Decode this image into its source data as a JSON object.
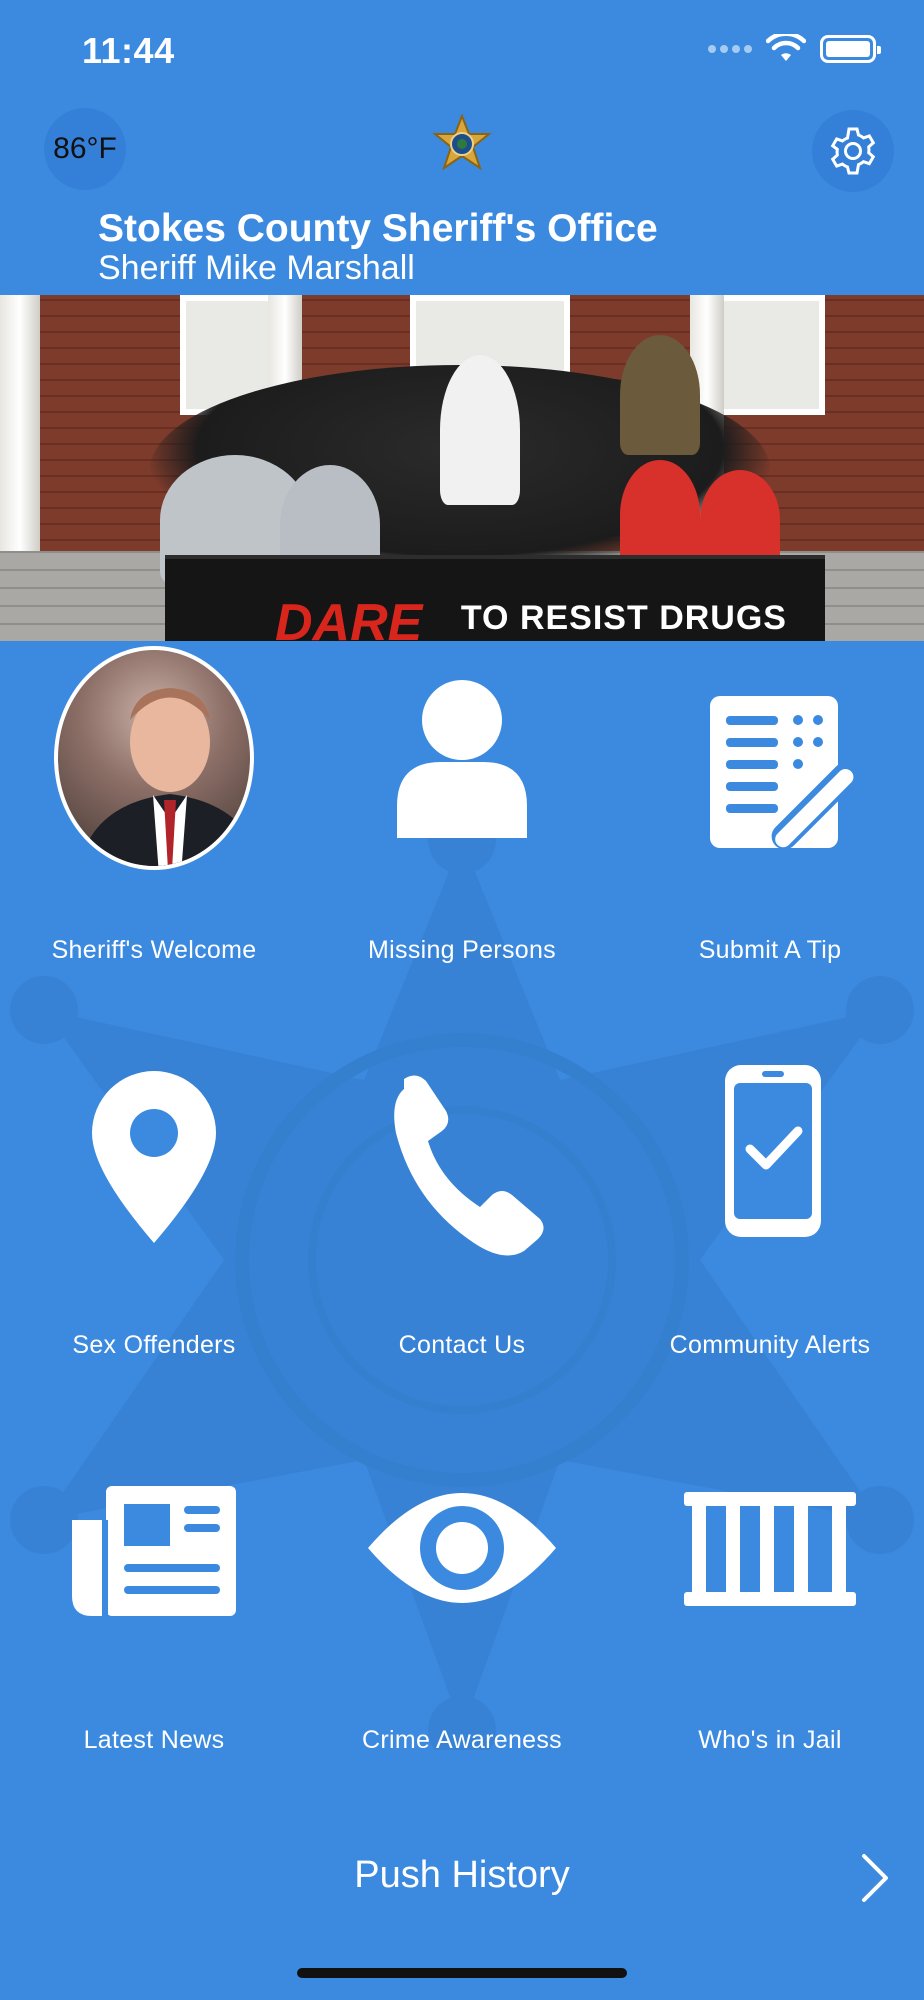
{
  "status": {
    "time": "11:44"
  },
  "header": {
    "weather": "86°F",
    "office_title": "Stokes County Sheriff's Office",
    "sheriff_name": "Sheriff Mike Marshall"
  },
  "hero": {
    "banner_text": "TO RESIST DRUGS",
    "banner_logo": "DARE"
  },
  "tiles": [
    {
      "label": "Sheriff's Welcome",
      "icon": "sheriff-photo"
    },
    {
      "label": "Missing Persons",
      "icon": "person-icon"
    },
    {
      "label": "Submit A Tip",
      "icon": "form-pencil-icon"
    },
    {
      "label": "Sex Offenders",
      "icon": "map-pin-icon"
    },
    {
      "label": "Contact Us",
      "icon": "phone-icon"
    },
    {
      "label": "Community Alerts",
      "icon": "phone-check-icon"
    },
    {
      "label": "Latest News",
      "icon": "newspaper-icon"
    },
    {
      "label": "Crime Awareness",
      "icon": "eye-icon"
    },
    {
      "label": "Who's in Jail",
      "icon": "jail-bars-icon"
    }
  ],
  "push": {
    "label": "Push History"
  },
  "colors": {
    "background": "#3b8ae0",
    "text": "#ffffff"
  }
}
